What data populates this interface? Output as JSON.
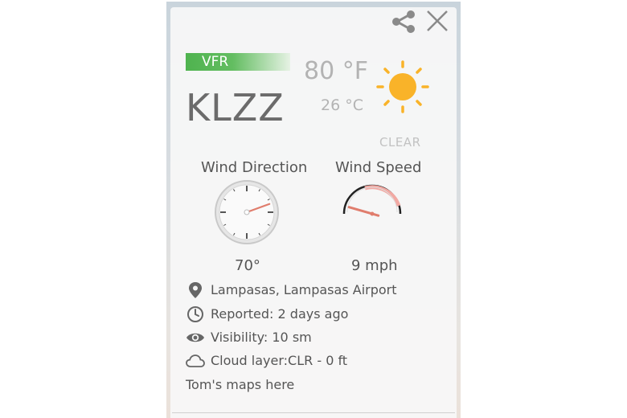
{
  "header": {
    "share_icon": "share-icon",
    "close_icon": "close-icon"
  },
  "station": {
    "flight_category": "VFR",
    "flight_category_color": "#4fb34f",
    "id": "KLZZ"
  },
  "weather": {
    "temp_f": "80 °F",
    "temp_c": "26 °C",
    "condition": "CLEAR",
    "icon": "sun-icon",
    "sun_color": "#f9b329"
  },
  "wind": {
    "direction_label": "Wind Direction",
    "direction_value": "70°",
    "direction_degrees": 70,
    "speed_label": "Wind Speed",
    "speed_value": "9 mph",
    "speed_mph": 9,
    "speed_scale_max": 100,
    "needle_color": "#e07d6d"
  },
  "details": [
    {
      "icon": "map-pin-icon",
      "text": "Lampasas, Lampasas Airport"
    },
    {
      "icon": "clock-icon",
      "text": "Reported: 2 days ago"
    },
    {
      "icon": "eye-icon",
      "text": "Visibility: 10 sm"
    },
    {
      "icon": "cloud-icon",
      "text": "Cloud layer:CLR - 0 ft"
    }
  ],
  "maps_link": "Tom's maps here"
}
